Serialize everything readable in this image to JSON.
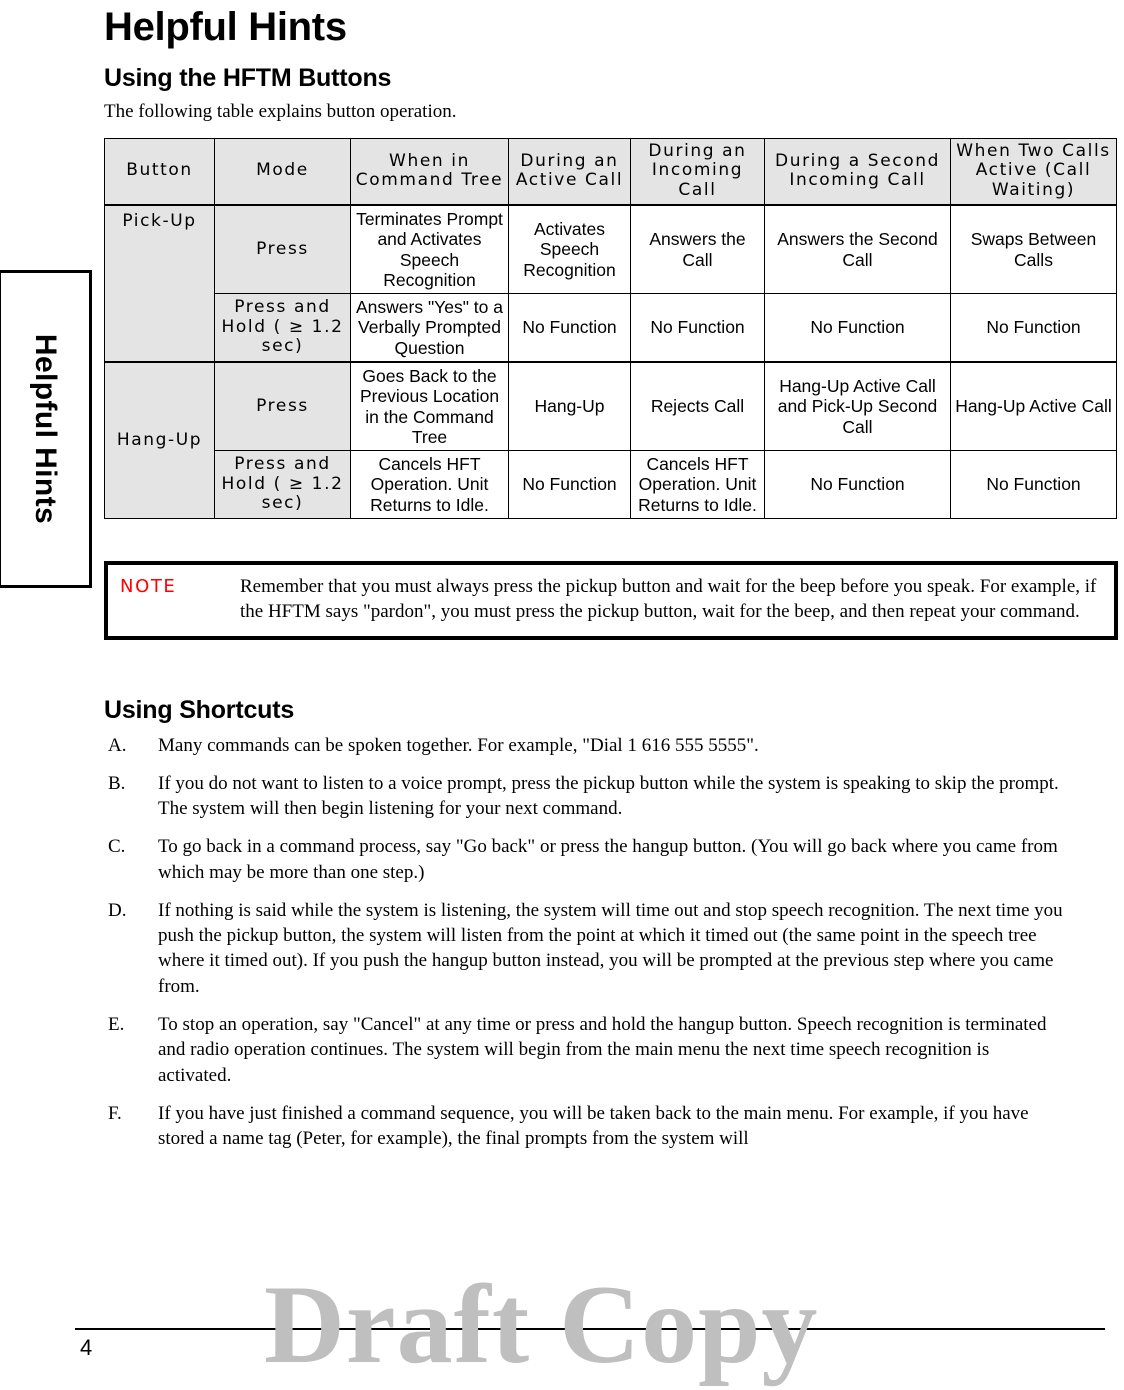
{
  "side_tab": {
    "label": "Helpful Hints"
  },
  "header": {
    "title": "Helpful Hints",
    "section_title": "Using the HFTM Buttons",
    "intro": "The following table explains button operation."
  },
  "table": {
    "columns": [
      "Button",
      "Mode",
      "When in Command Tree",
      "During an Active Call",
      "During an Incoming Call",
      "During a Second Incoming Call",
      "When Two Calls Active (Call Waiting)"
    ],
    "rows": [
      {
        "button": "Pick-Up",
        "mode": "Press",
        "command_tree": "Terminates Prompt and Activates Speech Recognition",
        "active_call": "Activates Speech Recognition",
        "incoming_call": "Answers the Call",
        "second_incoming_call": "Answers the Second Call",
        "two_calls_active": "Swaps Between Calls"
      },
      {
        "button": "",
        "mode": "Press and Hold ( ≥ 1.2 sec)",
        "command_tree": "Answers \"Yes\" to a Verbally Prompted Question",
        "active_call": "No Function",
        "incoming_call": "No Function",
        "second_incoming_call": "No Function",
        "two_calls_active": "No Function"
      },
      {
        "button": "Hang-Up",
        "mode": "Press",
        "command_tree": "Goes Back to the Previous Location in the Command Tree",
        "active_call": "Hang-Up",
        "incoming_call": "Rejects Call",
        "second_incoming_call": "Hang-Up Active Call and Pick-Up Second Call",
        "two_calls_active": "Hang-Up Active Call"
      },
      {
        "button": "",
        "mode": "Press and Hold ( ≥ 1.2 sec)",
        "command_tree": "Cancels HFT Operation. Unit Returns to Idle.",
        "active_call": "No Function",
        "incoming_call": "Cancels HFT Operation. Unit Returns to Idle.",
        "second_incoming_call": "No Function",
        "two_calls_active": "No Function"
      }
    ]
  },
  "note": {
    "label": "NOTE",
    "text": "Remember that you must always press the pickup button and wait for the beep before you speak. For example, if the HFTM says \"pardon\", you must press the pickup button, wait for the beep, and then repeat your command.",
    "label_color": "#ff0000"
  },
  "watermark": {
    "text": "Draft Copy",
    "color": "#bfbfbf"
  },
  "shortcuts": {
    "title": "Using Shortcuts",
    "items": [
      {
        "mark": "A.",
        "text": "Many commands can be spoken together. For example, \"Dial 1 616 555 5555\"."
      },
      {
        "mark": "B.",
        "text": "If you do not want to listen to a voice prompt, press the pickup button while the system is speaking to skip the prompt. The system will then begin listening for your next command."
      },
      {
        "mark": "C.",
        "text": "To go back in a command process, say \"Go back\" or press the hangup button. (You will go back where you came from which may be more than one step.)"
      },
      {
        "mark": "D.",
        "text": "If nothing is said while the system is listening, the system will time out and stop speech recognition. The next time you push the pickup button, the system will listen from the point at which it timed out (the same point in the speech tree where it timed out). If you push the hangup button instead, you will be prompted at the previous step where you came from."
      },
      {
        "mark": "E.",
        "text": "To stop an operation, say \"Cancel\" at any time or press and hold the hangup button. Speech recognition is terminated and radio operation continues. The system will begin from the main menu the next time speech recognition is activated."
      },
      {
        "mark": "F.",
        "text": "If you have just finished a command sequence, you will be taken back to the main menu. For example, if you have stored a name tag (Peter, for example), the final prompts from the system will"
      }
    ]
  },
  "footer": {
    "page_number": "4"
  }
}
